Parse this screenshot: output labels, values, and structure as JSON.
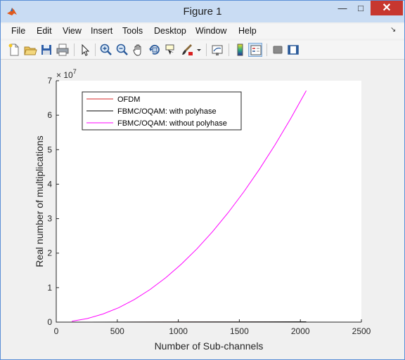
{
  "window": {
    "title": "Figure 1",
    "min_label": "—",
    "max_label": "□",
    "close_label": "✕"
  },
  "menu": [
    "File",
    "Edit",
    "View",
    "Insert",
    "Tools",
    "Desktop",
    "Window",
    "Help"
  ],
  "menu_overflow": "↘",
  "toolbar": {
    "buttons": [
      "new-figure-icon",
      "open-file-icon",
      "save-icon",
      "print-icon",
      "edit-plot-icon",
      "zoom-in-icon",
      "zoom-out-icon",
      "pan-icon",
      "rotate-3d-icon",
      "data-cursor-icon",
      "brush-icon",
      "brush-dropdown-icon",
      "link-plot-icon",
      "insert-colorbar-icon",
      "insert-legend-icon",
      "hide-plot-tools-icon",
      "show-plot-tools-icon"
    ]
  },
  "chart_data": {
    "type": "line",
    "xlabel": "Number of Sub-channels",
    "ylabel": "Real number of multiplications",
    "exponent_label": "× 10",
    "exponent_power": "7",
    "xlim": [
      0,
      2500
    ],
    "ylim": [
      0,
      7
    ],
    "xticks": [
      "0",
      "500",
      "1000",
      "1500",
      "2000",
      "2500"
    ],
    "yticks": [
      "0",
      "1",
      "2",
      "3",
      "4",
      "5",
      "6",
      "7"
    ],
    "legend_position": "top-left",
    "grid": false,
    "series": [
      {
        "name": "OFDM",
        "color": "#d62728",
        "x": [
          128,
          256,
          512,
          1024,
          2048
        ],
        "y": [
          0.00012,
          0.0003,
          0.0007,
          0.0016,
          0.0036
        ]
      },
      {
        "name": "FBMC/OQAM: with polyhase",
        "color": "#000000",
        "x": [
          128,
          256,
          512,
          1024,
          2048
        ],
        "y": [
          0.0004,
          0.0009,
          0.002,
          0.0044,
          0.0096
        ]
      },
      {
        "name": "FBMC/OQAM: without polyhase",
        "color": "#ff00ff",
        "x": [
          128,
          256,
          384,
          512,
          640,
          768,
          896,
          1024,
          1152,
          1280,
          1408,
          1536,
          1664,
          1792,
          1920,
          2048
        ],
        "y": [
          0.026,
          0.105,
          0.236,
          0.419,
          0.655,
          0.944,
          1.284,
          1.678,
          2.123,
          2.621,
          3.172,
          3.775,
          4.43,
          5.138,
          5.898,
          6.711
        ]
      }
    ]
  }
}
